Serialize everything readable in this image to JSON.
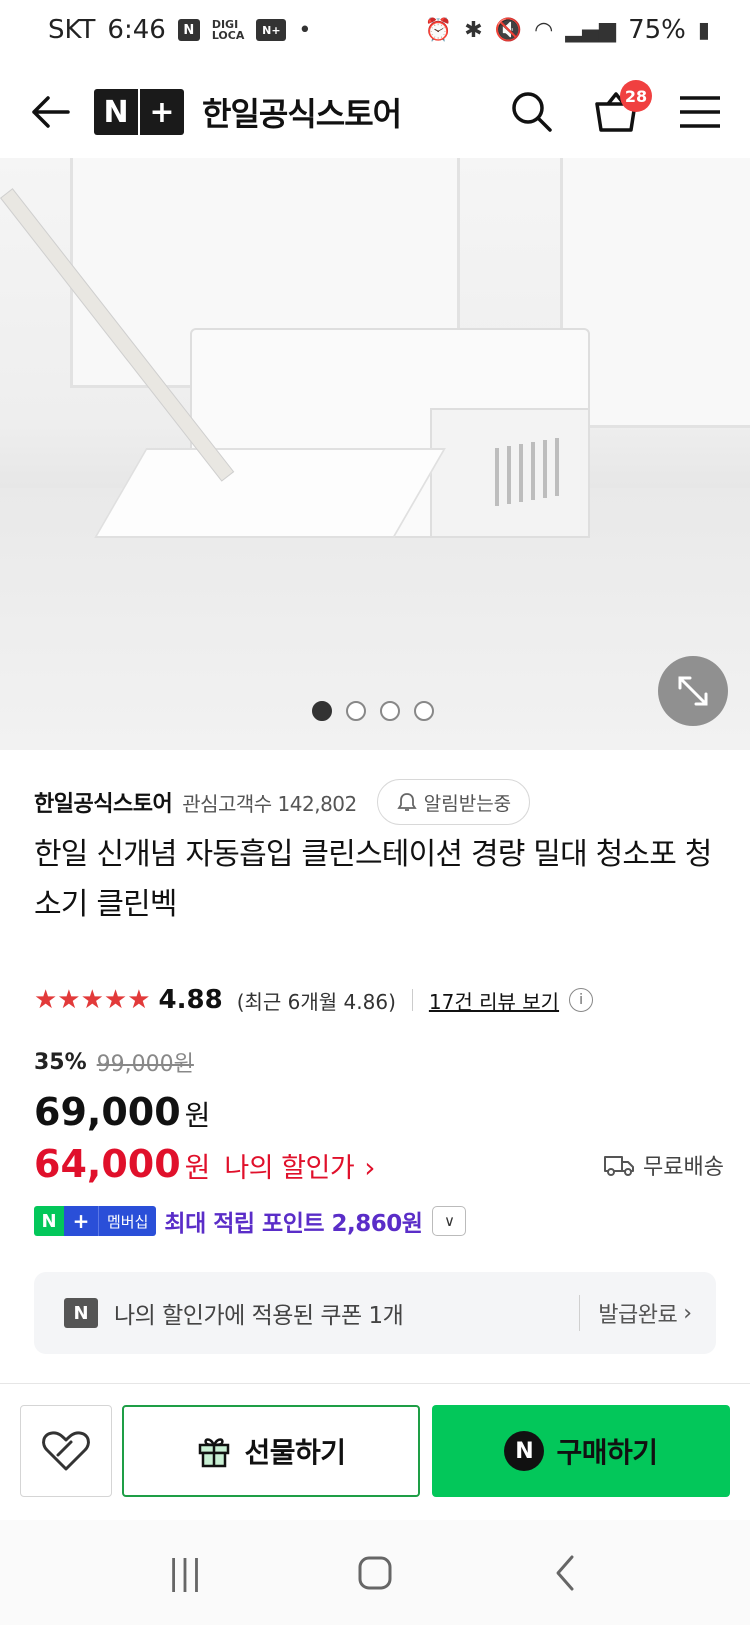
{
  "status_bar": {
    "carrier": "SKT",
    "time": "6:46",
    "badge_n": "N",
    "digi_line1": "DIGI",
    "digi_line2": "LOCA",
    "badge_np": "N+",
    "dot": "•",
    "battery": "75%"
  },
  "header": {
    "logo_n": "N",
    "logo_plus": "+",
    "store_title": "한일공식스토어",
    "cart_count": "28"
  },
  "gallery": {
    "total_dots": 4,
    "active_index": 0
  },
  "store": {
    "name": "한일공식스토어",
    "followers_label": "관심고객수 142,802",
    "alert_label": "알림받는중"
  },
  "product": {
    "title": "한일 신개념 자동흡입 클린스테이션 경량 밀대 청소포 청소기 클린벡"
  },
  "rating": {
    "stars": "★★★★★",
    "score": "4.88",
    "recent": "(최근 6개월 4.86)",
    "review_link": "17건 리뷰 보기",
    "info": "i"
  },
  "price": {
    "discount_rate": "35%",
    "original": "99,000원",
    "sale": "69,000",
    "currency": "원",
    "my_price": "64,000",
    "my_label": "나의 할인가",
    "my_chevron": "›",
    "shipping": "무료배송"
  },
  "membership": {
    "badge_n": "N",
    "badge_plus": "+",
    "badge_label": "멤버십",
    "points_text": "최대 적립 포인트 2,860원",
    "toggle": "∨"
  },
  "coupon": {
    "badge": "N",
    "text": "나의 할인가에 적용된 쿠폰 1개",
    "status": "발급완료",
    "chevron": "›"
  },
  "actions": {
    "gift_label": "선물하기",
    "buy_badge": "N",
    "buy_label": "구매하기"
  },
  "nav": {
    "recents": "|||",
    "home": "◯",
    "back": "‹"
  },
  "colors": {
    "naver_green": "#03c75a",
    "discount_red": "#e0102b",
    "points_purple": "#5a2dc8",
    "membership_blue": "#2a4fd8",
    "star_red": "#e23a3a"
  }
}
